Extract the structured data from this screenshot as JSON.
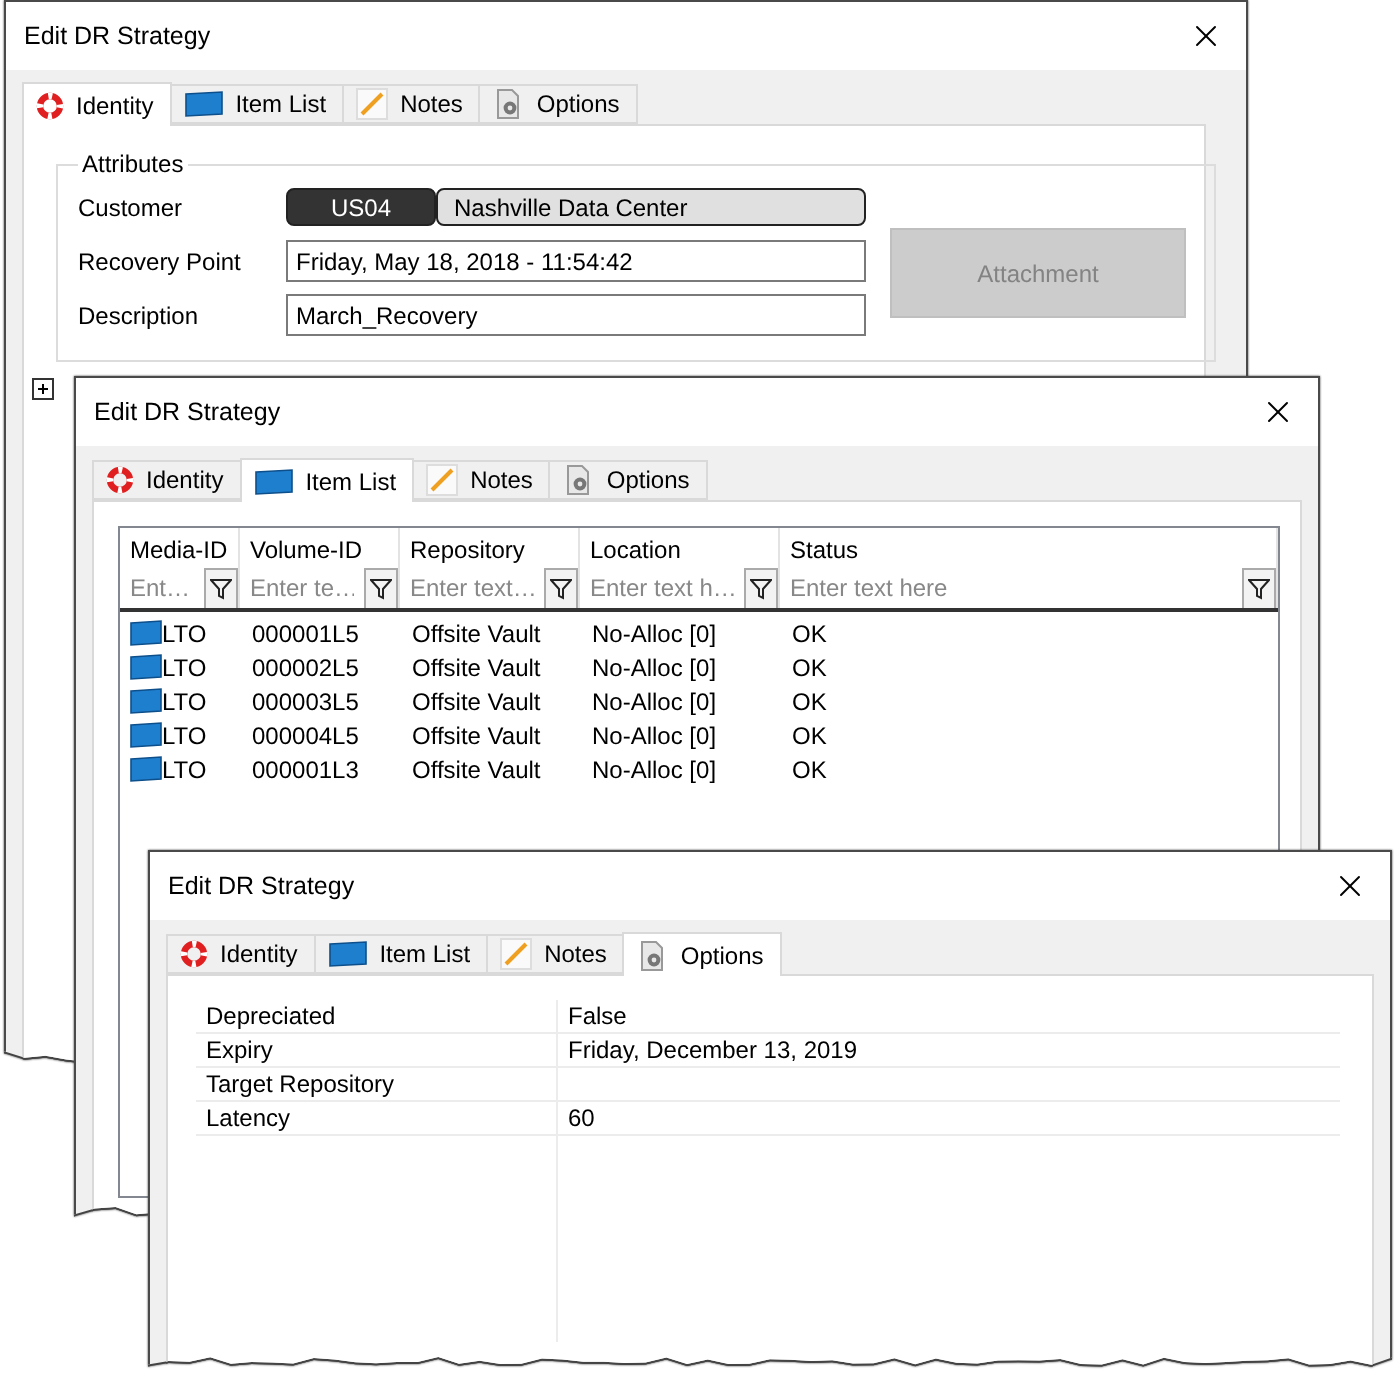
{
  "windows": [
    {
      "title": "Edit DR Strategy",
      "kind": "identity",
      "tabs": [
        {
          "label": "Identity",
          "selected": true
        },
        {
          "label": "Item List",
          "selected": false
        },
        {
          "label": "Notes",
          "selected": false
        },
        {
          "label": "Options",
          "selected": false
        }
      ],
      "group": {
        "title": "Attributes",
        "customer": {
          "label": "Customer",
          "code": "US04",
          "name": "Nashville Data Center"
        },
        "fields": [
          {
            "label": "Recovery Point",
            "value": "Friday, May 18, 2018 - 11:54:42"
          },
          {
            "label": "Description",
            "value": "March_Recovery"
          }
        ],
        "attachment": {
          "label": "Attachment",
          "disabled": true
        }
      }
    },
    {
      "title": "Edit DR Strategy",
      "kind": "item_list",
      "tabs": [
        {
          "label": "Identity",
          "selected": false
        },
        {
          "label": "Item List",
          "selected": true
        },
        {
          "label": "Notes",
          "selected": false
        },
        {
          "label": "Options",
          "selected": false
        }
      ],
      "columns": [
        {
          "label": "Media-ID",
          "placeholder": "Ent…"
        },
        {
          "label": "Volume-ID",
          "placeholder": "Enter te…"
        },
        {
          "label": "Repository",
          "placeholder": "Enter text…"
        },
        {
          "label": "Location",
          "placeholder": "Enter text h…"
        },
        {
          "label": "Status",
          "placeholder": "Enter text here"
        }
      ],
      "rows": [
        [
          "LTO",
          "000001L5",
          "Offsite Vault",
          "No-Alloc [0]",
          "OK"
        ],
        [
          "LTO",
          "000002L5",
          "Offsite Vault",
          "No-Alloc [0]",
          "OK"
        ],
        [
          "LTO",
          "000003L5",
          "Offsite Vault",
          "No-Alloc [0]",
          "OK"
        ],
        [
          "LTO",
          "000004L5",
          "Offsite Vault",
          "No-Alloc [0]",
          "OK"
        ],
        [
          "LTO",
          "000001L3",
          "Offsite Vault",
          "No-Alloc [0]",
          "OK"
        ]
      ]
    },
    {
      "title": "Edit DR Strategy",
      "kind": "options",
      "tabs": [
        {
          "label": "Identity",
          "selected": false
        },
        {
          "label": "Item List",
          "selected": false
        },
        {
          "label": "Notes",
          "selected": false
        },
        {
          "label": "Options",
          "selected": true
        }
      ],
      "properties": [
        {
          "label": "Depreciated",
          "value": "False"
        },
        {
          "label": "Expiry",
          "value": "Friday, December 13, 2019"
        },
        {
          "label": "Target Repository"
        },
        {
          "label": "Latency",
          "value": "60"
        }
      ]
    }
  ]
}
